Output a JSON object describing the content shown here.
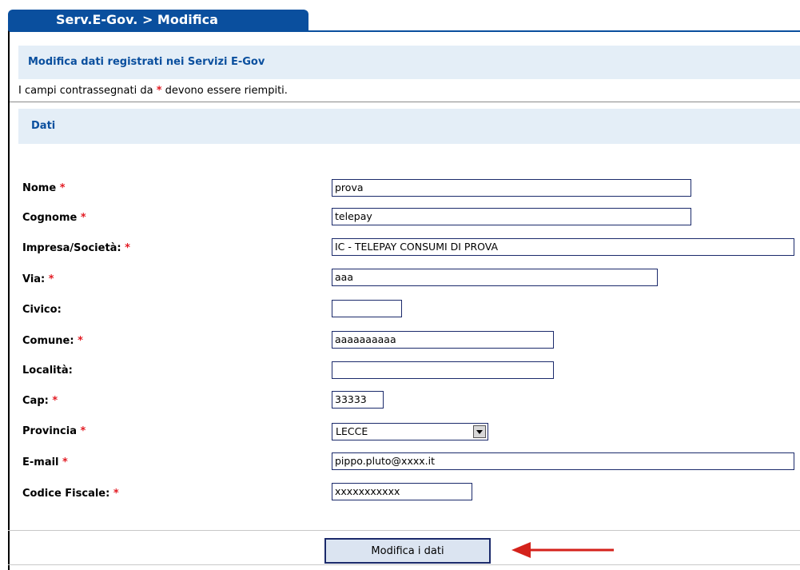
{
  "tab": {
    "label": "Serv.E-Gov. > Modifica"
  },
  "header": {
    "title": "Modifica dati registrati nei Servizi E-Gov"
  },
  "note": {
    "before": "I campi contrassegnati da ",
    "star": "*",
    "after": " devono essere riempiti."
  },
  "section": {
    "title": "Dati"
  },
  "fields": [
    {
      "label": "Nome",
      "required": "*",
      "value": "prova"
    },
    {
      "label": "Cognome",
      "required": "*",
      "value": "telepay"
    },
    {
      "label": "Impresa/Società:",
      "required": "*",
      "value": "IC - TELEPAY CONSUMI DI PROVA"
    },
    {
      "label": "Via:",
      "required": "*",
      "value": "aaa"
    },
    {
      "label": "Civico:",
      "required": "",
      "value": ""
    },
    {
      "label": "Comune:",
      "required": "*",
      "value": "aaaaaaaaaa"
    },
    {
      "label": "Località:",
      "required": "",
      "value": ""
    },
    {
      "label": "Cap:",
      "required": "*",
      "value": "33333"
    },
    {
      "label": "Provincia",
      "required": "*",
      "value": "LECCE"
    },
    {
      "label": "E-mail",
      "required": "*",
      "value": "pippo.pluto@xxxx.it"
    },
    {
      "label": "Codice Fiscale:",
      "required": "*",
      "value": "xxxxxxxxxxx"
    }
  ],
  "submit": {
    "label": "Modifica i dati"
  },
  "colors": {
    "brand": "#0a4f9e",
    "band": "#e4eef7",
    "required": "#e21b23",
    "arrow": "#d4221b"
  },
  "icons": {
    "select_arrow": "chevron-down-icon",
    "pointer": "arrow-left-icon"
  }
}
